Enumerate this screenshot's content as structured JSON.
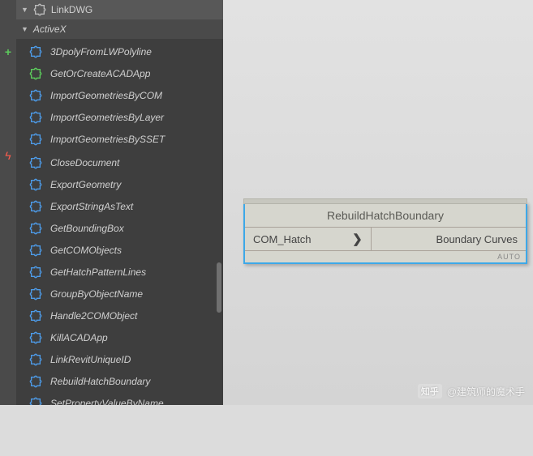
{
  "sidebar": {
    "root_label": "LinkDWG",
    "group_label": "ActiveX",
    "icon_color_default": "#4D9BE8",
    "icon_color_alt": "#5CCC5C",
    "items_plus": [
      {
        "label": "3DpolyFromLWPolyline",
        "color": "#4D9BE8"
      },
      {
        "label": "GetOrCreateACADApp",
        "color": "#5CCC5C"
      },
      {
        "label": "ImportGeometriesByCOM",
        "color": "#4D9BE8"
      },
      {
        "label": "ImportGeometriesByLayer",
        "color": "#4D9BE8"
      },
      {
        "label": "ImportGeometriesBySSET",
        "color": "#4D9BE8"
      }
    ],
    "items_bolt": [
      {
        "label": "CloseDocument",
        "color": "#4D9BE8"
      },
      {
        "label": "ExportGeometry",
        "color": "#4D9BE8"
      },
      {
        "label": "ExportStringAsText",
        "color": "#4D9BE8"
      },
      {
        "label": "GetBoundingBox",
        "color": "#4D9BE8"
      },
      {
        "label": "GetCOMObjects",
        "color": "#4D9BE8"
      },
      {
        "label": "GetHatchPatternLines",
        "color": "#4D9BE8"
      },
      {
        "label": "GroupByObjectName",
        "color": "#4D9BE8"
      },
      {
        "label": "Handle2COMObject",
        "color": "#4D9BE8"
      },
      {
        "label": "KillACADApp",
        "color": "#4D9BE8"
      },
      {
        "label": "LinkRevitUniqueID",
        "color": "#4D9BE8"
      },
      {
        "label": "RebuildHatchBoundary",
        "color": "#4D9BE8"
      },
      {
        "label": "SetPropertyValueByName",
        "color": "#4D9BE8"
      }
    ]
  },
  "node": {
    "title": "RebuildHatchBoundary",
    "input_label": "COM_Hatch",
    "output_label": "Boundary Curves",
    "footer": "AUTO"
  },
  "watermark": {
    "site": "知乎",
    "handle": "@建筑师的魔术手"
  }
}
